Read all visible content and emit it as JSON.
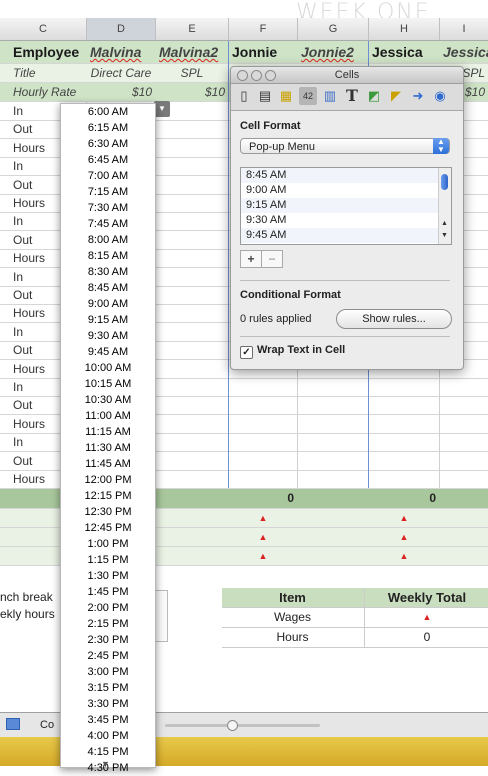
{
  "week_title": "WEEK ONE",
  "columns": [
    "C",
    "D",
    "E",
    "F",
    "G",
    "H",
    "I"
  ],
  "header": {
    "label": "Employee",
    "names": [
      "Malvina",
      "Malvina2",
      "Jonnie",
      "Jonnie2",
      "Jessica",
      "Jessica"
    ]
  },
  "title_row": {
    "label": "Title",
    "values": [
      "Direct Care",
      "SPL",
      "",
      "",
      "",
      "SPL"
    ]
  },
  "rate_row": {
    "label": "Hourly Rate",
    "values": [
      "$10",
      "$10",
      "",
      "",
      "",
      "$10"
    ]
  },
  "row_labels": [
    "In",
    "Out",
    "Hours",
    "In",
    "Out",
    "Hours",
    "In",
    "Out",
    "Hours",
    "In",
    "Out",
    "Hours",
    "In",
    "Out",
    "Hours",
    "In",
    "Out",
    "Hours",
    "In",
    "Out",
    "Hours"
  ],
  "totals": {
    "f": "0",
    "h": "0"
  },
  "popup_times": [
    "6:00 AM",
    "6:15 AM",
    "6:30 AM",
    "6:45 AM",
    "7:00 AM",
    "7:15 AM",
    "7:30 AM",
    "7:45 AM",
    "8:00 AM",
    "8:15 AM",
    "8:30 AM",
    "8:45 AM",
    "9:00 AM",
    "9:15 AM",
    "9:30 AM",
    "9:45 AM",
    "10:00 AM",
    "10:15 AM",
    "10:30 AM",
    "11:00 AM",
    "11:15 AM",
    "11:30 AM",
    "11:45 AM",
    "12:00 PM",
    "12:15 PM",
    "12:30 PM",
    "12:45 PM",
    "1:00 PM",
    "1:15 PM",
    "1:30 PM",
    "1:45 PM",
    "2:00 PM",
    "2:15 PM",
    "2:30 PM",
    "2:45 PM",
    "3:00 PM",
    "3:15 PM",
    "3:30 PM",
    "3:45 PM",
    "4:00 PM",
    "4:15 PM",
    "4:30 PM"
  ],
  "inspector": {
    "title": "Cells",
    "cell_format_heading": "Cell Format",
    "format_value": "Pop-up Menu",
    "list_items": [
      "8:45 AM",
      "9:00 AM",
      "9:15 AM",
      "9:30 AM",
      "9:45 AM"
    ],
    "add_label": "+",
    "remove_label": "−",
    "conditional_heading": "Conditional Format",
    "rules_status": "0 rules applied",
    "show_rules_label": "Show rules...",
    "wrap_label": "Wrap Text in Cell",
    "wrap_checked": true
  },
  "left_notes": {
    "lunch": "nch break",
    "weekly": "ekly hours"
  },
  "summary": {
    "headers": [
      "Item",
      "Weekly Total"
    ],
    "rows": [
      {
        "item": "Wages",
        "value": "▲"
      },
      {
        "item": "Hours",
        "value": "0"
      }
    ]
  },
  "sheet_tab": "Co",
  "colors": {
    "accent_green": "#cfe3c7",
    "header_green": "#a9c79c",
    "error_red": "#dd2222"
  }
}
